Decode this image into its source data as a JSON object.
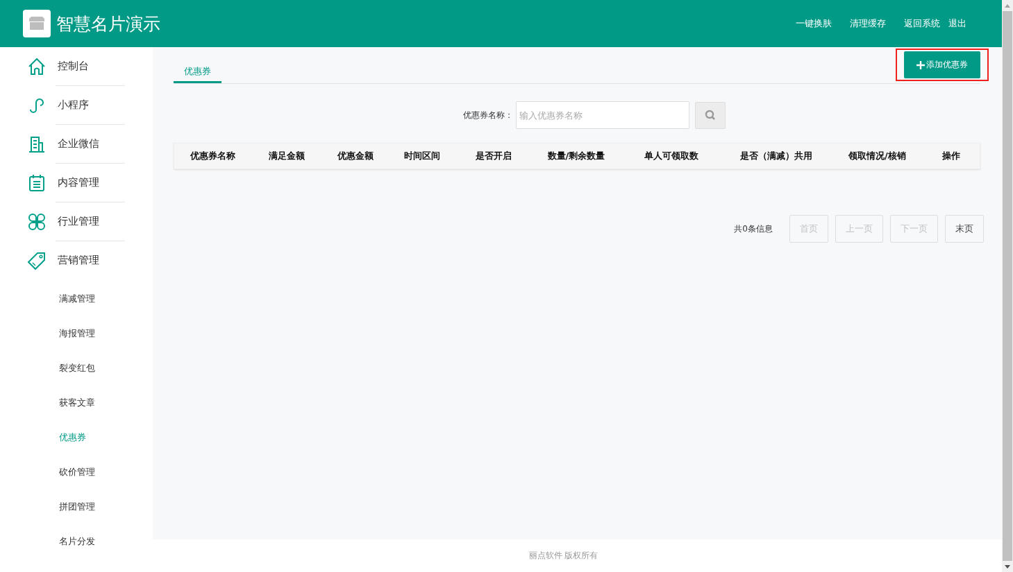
{
  "header": {
    "title": "智慧名片演示",
    "links": [
      "一键换肤",
      "清理缓存",
      "返回系统",
      "退出"
    ]
  },
  "sidebar": {
    "items": [
      {
        "label": "控制台",
        "selected": false
      },
      {
        "label": "小程序",
        "selected": false
      },
      {
        "label": "企业微信",
        "selected": false
      },
      {
        "label": "内容管理",
        "selected": false
      },
      {
        "label": "行业管理",
        "selected": false
      },
      {
        "label": "营销管理",
        "selected": false,
        "children": [
          {
            "label": "满减管理",
            "selected": false
          },
          {
            "label": "海报管理",
            "selected": false
          },
          {
            "label": "裂变红包",
            "selected": false
          },
          {
            "label": "获客文章",
            "selected": false
          },
          {
            "label": "优惠券",
            "selected": true
          },
          {
            "label": "砍价管理",
            "selected": false
          },
          {
            "label": "拼团管理",
            "selected": false
          },
          {
            "label": "名片分发",
            "selected": false
          }
        ]
      }
    ]
  },
  "tabs": [
    {
      "label": "优惠券",
      "selected": true
    }
  ],
  "add_button": {
    "label": "添加优惠券",
    "highlighted": true
  },
  "search": {
    "label": "优惠券名称：",
    "placeholder": "输入优惠券名称"
  },
  "table": {
    "columns": [
      "优惠券名称",
      "满足金额",
      "优惠金额",
      "时间区间",
      "是否开启",
      "数量/剩余数量",
      "单人可领取数",
      "是否（满减）共用",
      "领取情况/核销",
      "操作"
    ]
  },
  "pagination": {
    "summary": "共0条信息",
    "buttons": [
      {
        "label": "首页",
        "disabled": true
      },
      {
        "label": "上一页",
        "disabled": true
      },
      {
        "label": "下一页",
        "disabled": true
      },
      {
        "label": "末页",
        "disabled": false
      }
    ]
  },
  "footer": "丽点软件 版权所有"
}
